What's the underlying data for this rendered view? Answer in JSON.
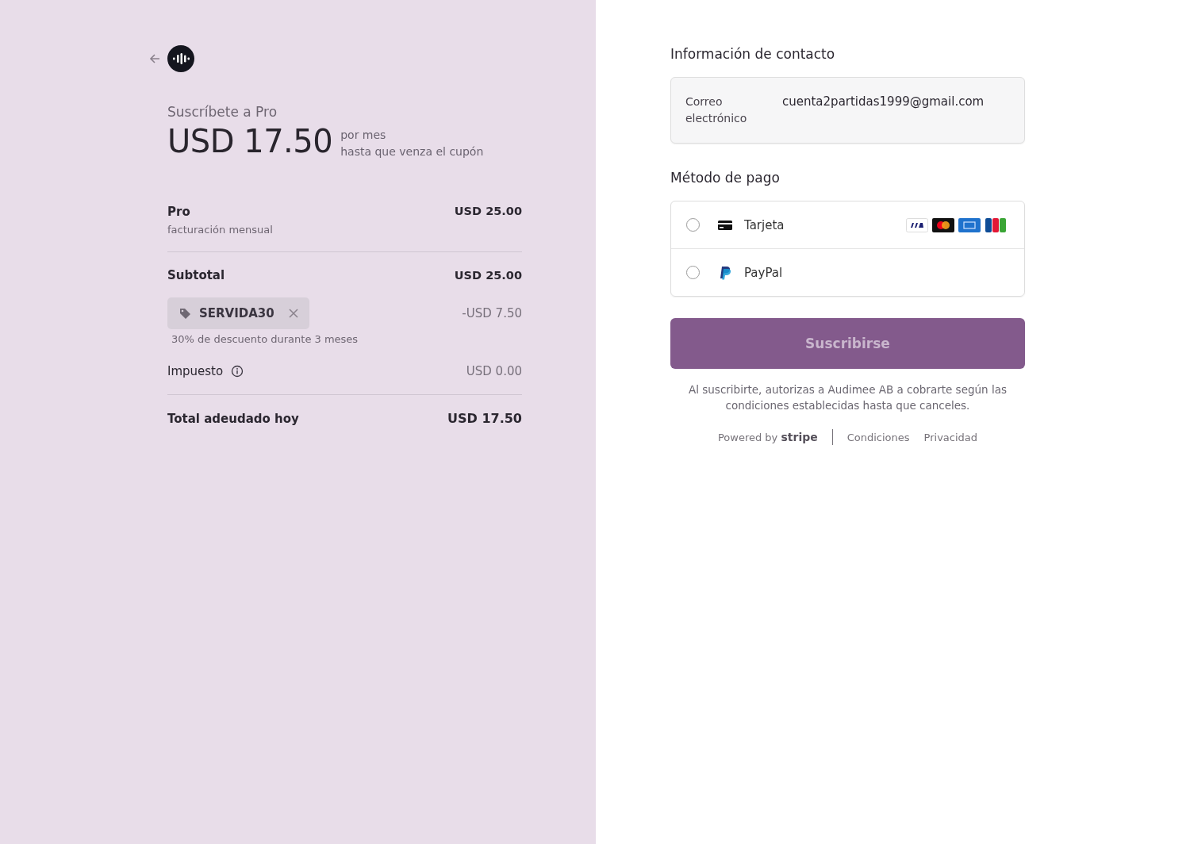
{
  "summary": {
    "heading": "Suscríbete a Pro",
    "price": "USD 17.50",
    "period": "por mes",
    "period_note": "hasta que venza el cupón",
    "item": {
      "name": "Pro",
      "note": "facturación mensual",
      "amount": "USD 25.00"
    },
    "subtotal": {
      "label": "Subtotal",
      "amount": "USD 25.00"
    },
    "coupon": {
      "code": "SERVIDA30",
      "amount": "-USD 7.50",
      "note": "30% de descuento durante 3 meses"
    },
    "tax": {
      "label": "Impuesto",
      "amount": "USD 0.00"
    },
    "total": {
      "label": "Total adeudado hoy",
      "amount": "USD 17.50"
    }
  },
  "contact": {
    "title": "Información de contacto",
    "email_label": "Correo electrónico",
    "email": "cuenta2partidas1999@gmail.com"
  },
  "payment": {
    "title": "Método de pago",
    "options": [
      {
        "kind": "card",
        "label": "Tarjeta",
        "selected": false
      },
      {
        "kind": "paypal",
        "label": "PayPal",
        "selected": false
      }
    ]
  },
  "submit": {
    "label": "Suscribirse",
    "disabled": true
  },
  "legal": "Al suscribirte, autorizas a Audimee AB a cobrarte según las condiciones establecidas hasta que canceles.",
  "footer": {
    "powered": "Powered by **stripe**",
    "links": [
      "Condiciones",
      "Privacidad"
    ]
  }
}
